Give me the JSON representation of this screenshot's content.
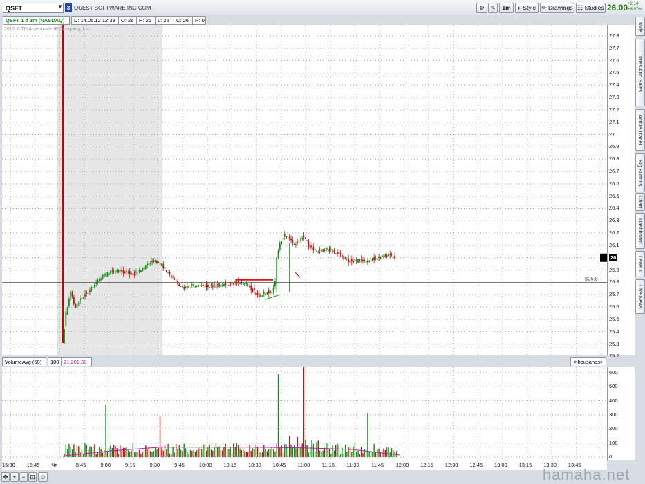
{
  "header": {
    "symbol": "QSFT",
    "symbol_badge": "3",
    "company": "QUEST SOFTWARE INC COM",
    "period_button": "1m",
    "style_label": "Style",
    "drawings_label": "Drawings",
    "studies_label": "Studies",
    "last_price": "26.00",
    "change_abs": "+2.14",
    "change_pct": "+8.97%"
  },
  "infobar": {
    "title": "QSFT 1 d 1m [NASDAQ]",
    "date": "D: 14.06.12 12:39",
    "open": "O: 26",
    "high": "H: 26",
    "low": "L: 26",
    "close": "C: 26",
    "range": "R: 0",
    "copyright": "2012 © TD Ameritrade IP Company, Inc."
  },
  "volume": {
    "label": "VolumeAvg (50)",
    "value1": "100",
    "value2": "21,201.38",
    "units": "<thousands>"
  },
  "side_tabs": [
    "Trade",
    "Times And Sales",
    "Active Trader",
    "Big Buttons",
    "Chart",
    "Dashboard",
    "Level II",
    "Live News"
  ],
  "watermark": "hamaha.net",
  "colors": {
    "up": "#1a8a1a",
    "down": "#c81010",
    "marker": "#cc0000",
    "avg": "#b020b0"
  },
  "chart_data": {
    "type": "line",
    "title": "QSFT 1 d 1m [NASDAQ]",
    "ylim": [
      25.2,
      27.9
    ],
    "price_ticks": [
      "27.8",
      "27.7",
      "27.6",
      "27.5",
      "27.4",
      "27.3",
      "27.2",
      "27.1",
      "27",
      "26.9",
      "26.8",
      "26.7",
      "26.6",
      "26.5",
      "26.4",
      "26.3",
      "26.2",
      "26.1",
      "26",
      "25.9",
      "25.8",
      "25.7",
      "25.6",
      "25.5",
      "25.4",
      "25.3",
      "25.2"
    ],
    "current_price_label": "26",
    "level_label": "$25.8",
    "level": 25.8,
    "x_ticks": [
      "15:30",
      "15:45",
      "Чт",
      "8:45",
      "9:00",
      "9:15",
      "9:30",
      "9:45",
      "10:00",
      "10:15",
      "10:30",
      "10:45",
      "11:00",
      "11:15",
      "11:30",
      "11:45",
      "12:00",
      "12:15",
      "12:30",
      "12:45",
      "13:00",
      "13:15",
      "13:30",
      "13:45"
    ],
    "price_path": [
      [
        0,
        25.32
      ],
      [
        2,
        25.55
      ],
      [
        5,
        25.72
      ],
      [
        8,
        25.6
      ],
      [
        12,
        25.68
      ],
      [
        16,
        25.72
      ],
      [
        20,
        25.78
      ],
      [
        25,
        25.85
      ],
      [
        30,
        25.88
      ],
      [
        35,
        25.89
      ],
      [
        40,
        25.88
      ],
      [
        45,
        25.87
      ],
      [
        50,
        25.91
      ],
      [
        55,
        25.96
      ],
      [
        58,
        25.98
      ],
      [
        62,
        25.94
      ],
      [
        66,
        25.88
      ],
      [
        70,
        25.82
      ],
      [
        75,
        25.76
      ],
      [
        80,
        25.77
      ],
      [
        85,
        25.78
      ],
      [
        90,
        25.77
      ],
      [
        95,
        25.77
      ],
      [
        100,
        25.78
      ],
      [
        105,
        25.79
      ],
      [
        110,
        25.8
      ],
      [
        115,
        25.78
      ],
      [
        119,
        25.74
      ],
      [
        122,
        25.69
      ],
      [
        125,
        25.7
      ],
      [
        128,
        25.72
      ],
      [
        131,
        25.72
      ],
      [
        133,
        25.8
      ],
      [
        134,
        26.0
      ],
      [
        136,
        26.12
      ],
      [
        139,
        26.18
      ],
      [
        142,
        26.15
      ],
      [
        145,
        26.1
      ],
      [
        148,
        26.14
      ],
      [
        151,
        26.18
      ],
      [
        154,
        26.1
      ],
      [
        157,
        26.06
      ],
      [
        160,
        26.05
      ],
      [
        165,
        26.07
      ],
      [
        170,
        26.05
      ],
      [
        174,
        26.02
      ],
      [
        178,
        25.98
      ],
      [
        182,
        25.97
      ],
      [
        186,
        25.98
      ],
      [
        190,
        25.97
      ],
      [
        194,
        25.99
      ],
      [
        198,
        26.0
      ],
      [
        202,
        26.02
      ],
      [
        205,
        26.02
      ],
      [
        208,
        26.0
      ]
    ],
    "volume_ylim": [
      0,
      600
    ],
    "volume_ticks": [
      "600",
      "500",
      "400",
      "300",
      "200",
      "100",
      "0"
    ],
    "volume_avg": [
      [
        0,
        10
      ],
      [
        30,
        45
      ],
      [
        60,
        70
      ],
      [
        90,
        70
      ],
      [
        120,
        70
      ],
      [
        150,
        65
      ],
      [
        180,
        55
      ],
      [
        210,
        15
      ]
    ]
  }
}
